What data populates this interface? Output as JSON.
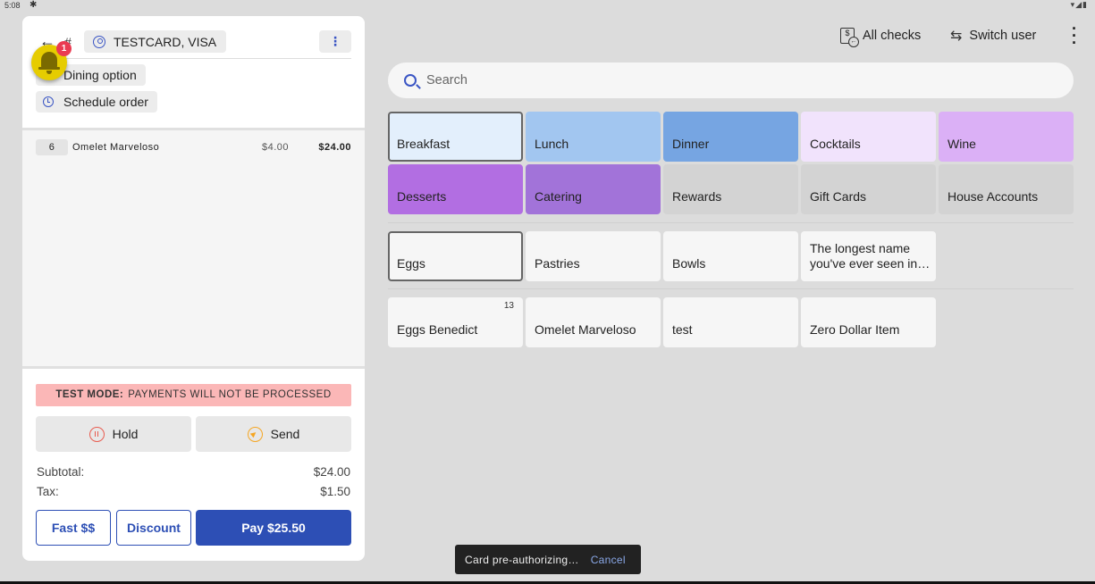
{
  "status_bar": {
    "time": "5:08",
    "settings_icon": "gear-icon",
    "system_icons": "▾◢▮"
  },
  "order": {
    "back_icon": "←",
    "hash": "#",
    "customer_chip": "TESTCARD, VISA",
    "more_icon": "⋮",
    "dining_option": "Dining option",
    "schedule_order": "Schedule order",
    "lines": [
      {
        "qty": "6",
        "name": "Omelet Marveloso",
        "unit_price": "$4.00",
        "total": "$24.00"
      }
    ],
    "test_mode_label": "TEST MODE:",
    "test_mode_text": "PAYMENTS WILL NOT BE PROCESSED",
    "hold_label": "Hold",
    "send_label": "Send",
    "subtotal_label": "Subtotal:",
    "subtotal_value": "$24.00",
    "tax_label": "Tax:",
    "tax_value": "$1.50",
    "fast_cash_label": "Fast $$",
    "discount_label": "Discount",
    "pay_label": "Pay $25.50"
  },
  "notifications": {
    "badge_count": "1",
    "color": "#e6cc00"
  },
  "toolbar": {
    "all_checks": "All checks",
    "switch_user": "Switch user",
    "switch_icon": "⇆",
    "overflow_icon": "⋮",
    "search_placeholder": "Search"
  },
  "categories": [
    {
      "label": "Breakfast",
      "color": "#e3effc",
      "selected": true
    },
    {
      "label": "Lunch",
      "color": "#a2c6f0",
      "selected": false
    },
    {
      "label": "Dinner",
      "color": "#76a5e2",
      "selected": false
    },
    {
      "label": "Cocktails",
      "color": "#f1e3fc",
      "selected": false
    },
    {
      "label": "Wine",
      "color": "#dbb0f6",
      "selected": false
    },
    {
      "label": "Desserts",
      "color": "#b26ee2",
      "selected": false
    },
    {
      "label": "Catering",
      "color": "#a273d9",
      "selected": false
    },
    {
      "label": "Rewards",
      "color": "#d3d3d3",
      "selected": false
    },
    {
      "label": "Gift Cards",
      "color": "#d3d3d3",
      "selected": false
    },
    {
      "label": "House Accounts",
      "color": "#d3d3d3",
      "selected": false
    }
  ],
  "subcategories": [
    {
      "label": "Eggs",
      "selected": true
    },
    {
      "label": "Pastries",
      "selected": false
    },
    {
      "label": "Bowls",
      "selected": false
    },
    {
      "label": "The longest name you've ever seen in…",
      "selected": false
    }
  ],
  "items": [
    {
      "label": "Eggs Benedict",
      "count": "13"
    },
    {
      "label": "Omelet Marveloso",
      "count": ""
    },
    {
      "label": "test",
      "count": ""
    },
    {
      "label": "Zero Dollar Item",
      "count": ""
    }
  ],
  "snackbar": {
    "message": "Card pre-authorizing…",
    "action": "Cancel"
  }
}
